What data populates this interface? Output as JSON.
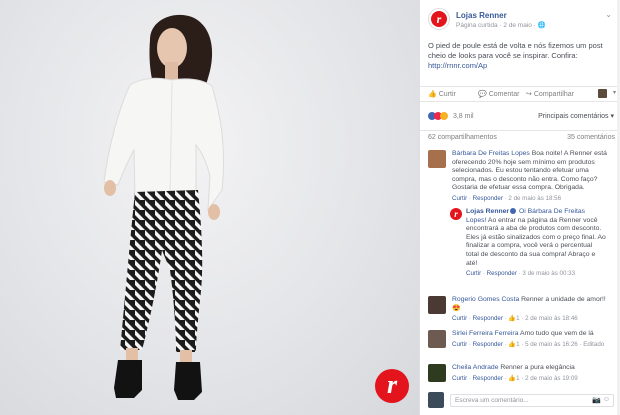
{
  "post": {
    "page_name": "Lojas Renner",
    "page_meta": "Página curtida · 2 de maio · ",
    "text": "O pied de poule está de volta e nós fizemos um post cheio de looks para você se inspirar. Confira: ",
    "link": "http://rnnr.com/Ap"
  },
  "actions": {
    "like": "Curtir",
    "comment": "Comentar",
    "share": "Compartilhar"
  },
  "reactions": {
    "count": "3,8 mil",
    "relevant": "Principais comentários"
  },
  "stats": {
    "shares": "62 compartilhamentos",
    "comments": "35 comentários"
  },
  "comments": [
    {
      "name": "Bárbara De Freitas Lopes",
      "text": " Boa noite! A Renner está oferecendo 20% hoje sem mínimo em produtos selecionados. Eu estou tentando efetuar uma compra, mas o desconto não entra. Como faço? Gostaria de efetuar essa compra. Obrigada.",
      "meta_like": "Curtir",
      "meta_reply": "Responder",
      "meta_time": "2 de maio às 18:56",
      "avatar_color": "#a6704d"
    },
    {
      "name": "Lojas Renner",
      "mention": "Oi Bárbara De Freitas Lopes!",
      "text": " Ao entrar na página da Renner você encontrará a aba de produtos com desconto. Eles já estão sinalizados com o preço final. Ao finalizar a compra, você verá o percentual total de desconto da sua compra! Abraço e até!",
      "meta_like": "Curtir",
      "meta_reply": "Responder",
      "meta_time": "3 de maio às 00:33"
    },
    {
      "name": "Rogerio Gomes Costa",
      "text": " Renner a unidade de amor!!😍",
      "meta_like": "Curtir",
      "meta_reply": "Responder",
      "meta_count": "1",
      "meta_time": "2 de maio às 18:46",
      "avatar_color": "#4a3a33"
    },
    {
      "name": "Sirlei Ferreira Ferreira",
      "text": " Amo tudo que vem de lá",
      "meta_like": "Curtir",
      "meta_reply": "Responder",
      "meta_count": "1",
      "meta_time": "5 de maio às 16:26",
      "meta_extra": "Editado",
      "avatar_color": "#6d5b52"
    },
    {
      "name": "Cheila Andrade",
      "text": " Renner a pura elegância",
      "meta_like": "Curtir",
      "meta_reply": "Responder",
      "meta_count": "1",
      "meta_time": "2 de maio às 19:09",
      "avatar_color": "#2f3b1f"
    }
  ],
  "write": {
    "placeholder": "Escreva um comentário..."
  }
}
